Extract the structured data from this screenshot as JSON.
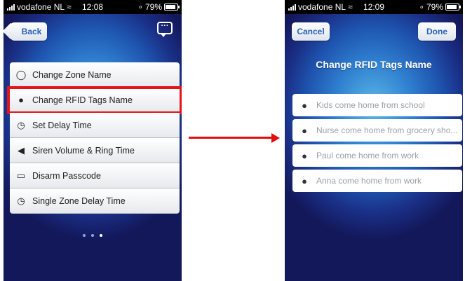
{
  "status_left": {
    "carrier": "vodafone NL",
    "time": "12:08",
    "battery": "79%"
  },
  "status_right": {
    "carrier": "vodafone NL",
    "time": "12:09",
    "battery": "79%"
  },
  "left_screen": {
    "back_label": "Back",
    "menu_items": [
      {
        "label": "Change Zone Name",
        "icon": "shield-icon"
      },
      {
        "label": "Change RFID Tags Name",
        "icon": "person-icon"
      },
      {
        "label": "Set Delay Time",
        "icon": "timer-icon"
      },
      {
        "label": "Siren Volume & Ring Time",
        "icon": "speaker-icon"
      },
      {
        "label": "Disarm Passcode",
        "icon": "unlock-icon"
      },
      {
        "label": "Single Zone Delay Time",
        "icon": "timer-icon"
      }
    ],
    "selected_index": 1,
    "page_count": 3,
    "current_page": 3
  },
  "right_screen": {
    "cancel_label": "Cancel",
    "done_label": "Done",
    "title": "Change RFID Tags Name",
    "fields": [
      {
        "placeholder": "Kids come home from school",
        "icon": "person-icon"
      },
      {
        "placeholder": "Nurse come home from grocery sho...",
        "icon": "person-icon"
      },
      {
        "placeholder": "Paul come home from work",
        "icon": "person-icon"
      },
      {
        "placeholder": "Anna come home from work",
        "icon": "person-icon"
      }
    ]
  },
  "colors": {
    "highlight": "#e4141b",
    "button_text": "#2660b8",
    "arrow": "#e30d0d"
  }
}
